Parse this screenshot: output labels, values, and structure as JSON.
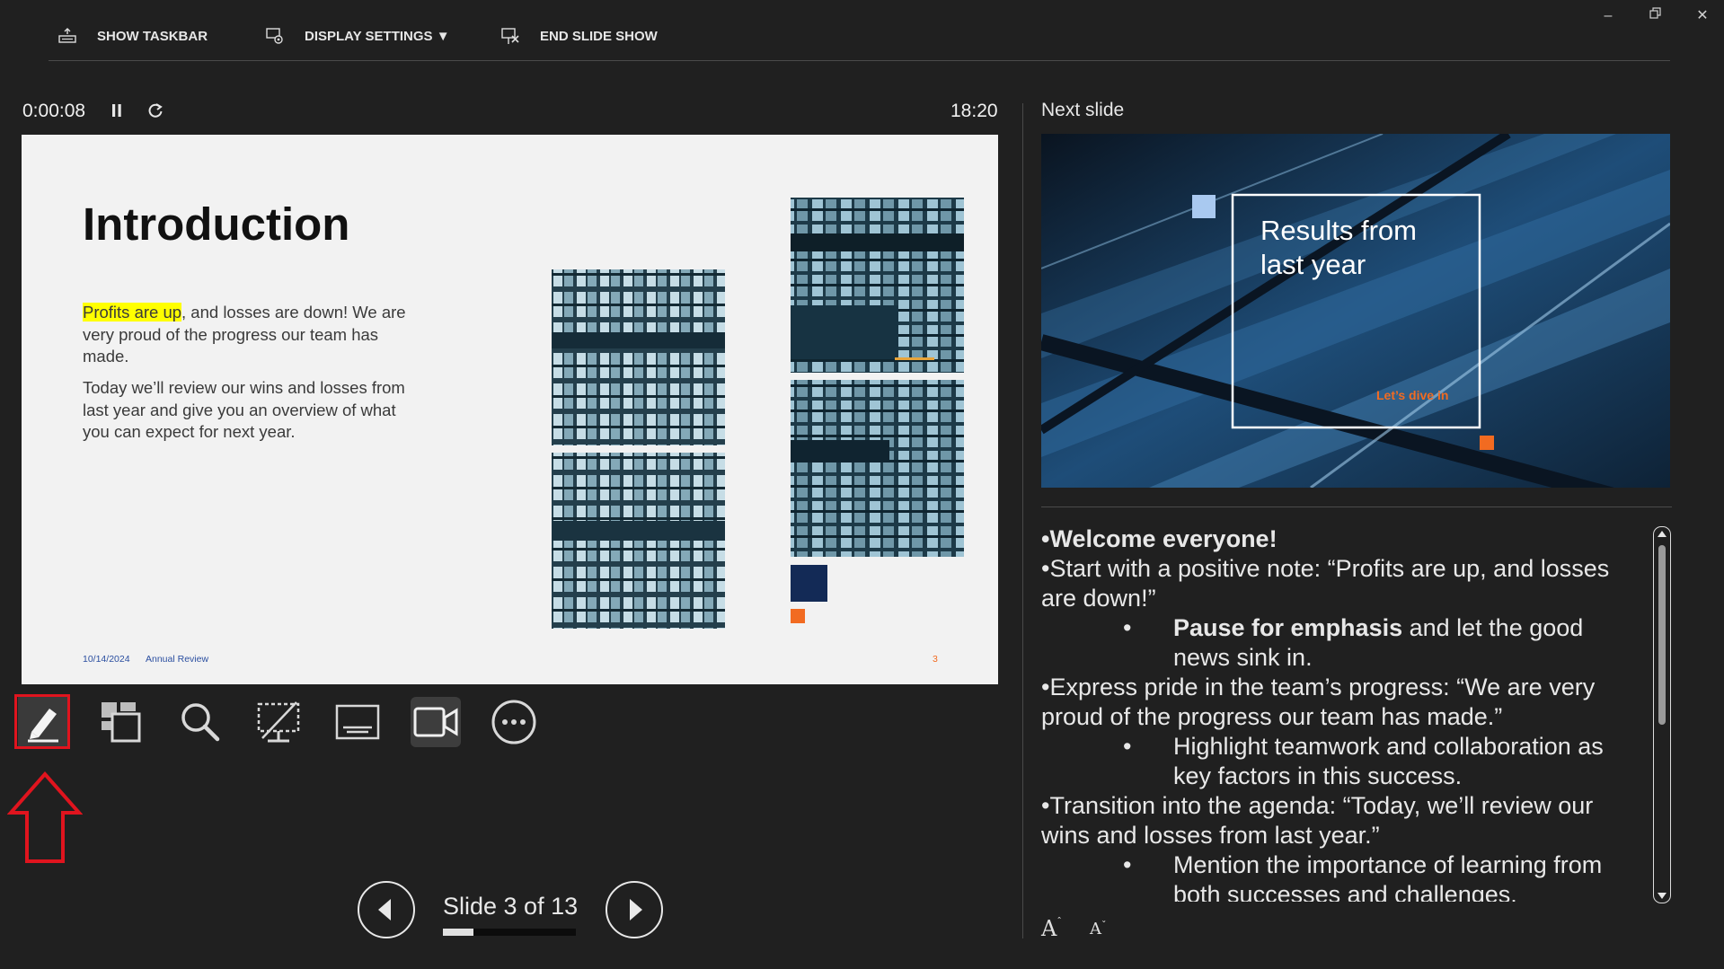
{
  "toolbar": {
    "show_taskbar": "SHOW TASKBAR",
    "display_settings": "DISPLAY SETTINGS ▼",
    "end_slide_show": "END SLIDE SHOW"
  },
  "timer": {
    "elapsed": "0:00:08",
    "clock": "18:20"
  },
  "slide": {
    "title": "Introduction",
    "highlight": "Profits are up",
    "para1_rest": ", and losses are down! We are very proud of the progress our team has made.",
    "para2": "Today we’ll review our wins and losses from last year and give you an overview of what you can expect for next year.",
    "footer_date": "10/14/2024",
    "footer_title": "Annual Review",
    "footer_page": "3"
  },
  "next_slide": {
    "label": "Next slide",
    "title_line1": "Results from",
    "title_line2": "last year",
    "subtitle": "Let’s dive in"
  },
  "navigation": {
    "slide_counter": "Slide 3 of 13",
    "progress_fraction": 0.23
  },
  "notes": {
    "line1": "•Welcome everyone!",
    "line2": "•Start with a positive note: “Profits are up, and losses are down!”",
    "line3_bold": "Pause for emphasis",
    "line3_rest": " and let the good news sink in.",
    "line4": "•Express pride in the team’s progress: “We are very proud of the progress our team has made.”",
    "line5": "Highlight teamwork and collaboration as key factors in this success.",
    "line6": "•Transition into the agenda: “Today, we’ll review our wins and losses from last year.”",
    "line7": "Mention the importance of learning from both successes and challenges."
  },
  "icons": {
    "pen": "pen-tool-icon",
    "all_slides": "all-slides-icon",
    "zoom": "zoom-icon",
    "black_screen": "black-screen-icon",
    "subtitles": "subtitles-icon",
    "camera": "camera-icon",
    "more": "more-options-icon"
  },
  "colors": {
    "background": "#202020",
    "highlight": "#ffff00",
    "annotation_red": "#e0141e",
    "accent_orange": "#f26b21",
    "accent_blue": "#2b5aa0"
  }
}
